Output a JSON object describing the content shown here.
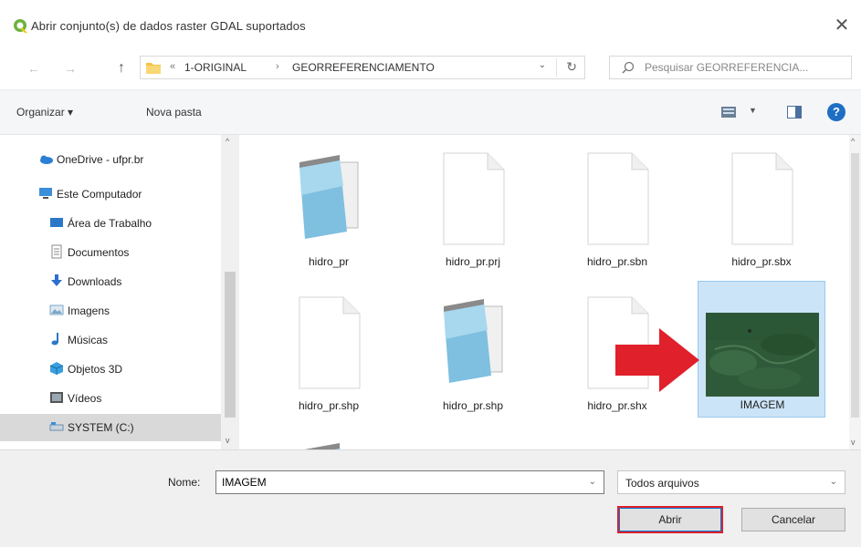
{
  "window": {
    "title": "Abrir conjunto(s) de dados raster GDAL suportados",
    "close_glyph": "✕"
  },
  "address_bar": {
    "overflow": "«",
    "crumbs": [
      "1-ORIGINAL",
      "GEORREFERENCIAMENTO"
    ],
    "separator": "›"
  },
  "search": {
    "placeholder": "Pesquisar GEORREFERENCIA..."
  },
  "toolbar": {
    "organize_label": "Organizar ▾",
    "new_folder_label": "Nova pasta",
    "help_glyph": "?"
  },
  "sidebar": {
    "items": [
      {
        "label": "OneDrive - ufpr.br",
        "icon": "cloud-icon",
        "color": "#2a7fd4"
      },
      {
        "label": "Este Computador",
        "icon": "computer-icon",
        "color": "#3a8fd8"
      },
      {
        "label": "Área de Trabalho",
        "icon": "desktop-icon",
        "color": "#2b78c9"
      },
      {
        "label": "Documentos",
        "icon": "documents-icon",
        "color": "#8a8a8a"
      },
      {
        "label": "Downloads",
        "icon": "download-icon",
        "color": "#2b6fd0"
      },
      {
        "label": "Imagens",
        "icon": "pictures-icon",
        "color": "#7aa7c7"
      },
      {
        "label": "Músicas",
        "icon": "music-icon",
        "color": "#2b78c9"
      },
      {
        "label": "Objetos 3D",
        "icon": "objects-3d-icon",
        "color": "#3aa0e0"
      },
      {
        "label": "Vídeos",
        "icon": "videos-icon",
        "color": "#555555"
      },
      {
        "label": "SYSTEM (C:)",
        "icon": "drive-icon",
        "color": "#6d8fb0"
      }
    ]
  },
  "files": [
    {
      "name": "hidro_pr",
      "type": "notepad"
    },
    {
      "name": "hidro_pr.prj",
      "type": "blank"
    },
    {
      "name": "hidro_pr.sbn",
      "type": "blank"
    },
    {
      "name": "hidro_pr.sbx",
      "type": "blank"
    },
    {
      "name": "hidro_pr.shp",
      "type": "blank"
    },
    {
      "name": "hidro_pr.shp",
      "type": "notepad"
    },
    {
      "name": "hidro_pr.shx",
      "type": "blank"
    },
    {
      "name": "IMAGEM",
      "type": "image"
    },
    {
      "name": "",
      "type": "notepad"
    }
  ],
  "bottom": {
    "name_label": "Nome:",
    "name_value": "IMAGEM",
    "filter_value": "Todos arquivos",
    "open_label": "Abrir",
    "cancel_label": "Cancelar"
  },
  "colors": {
    "accent": "#0078d7",
    "highlight_red": "#e0202a",
    "selection": "#cce4f7"
  }
}
